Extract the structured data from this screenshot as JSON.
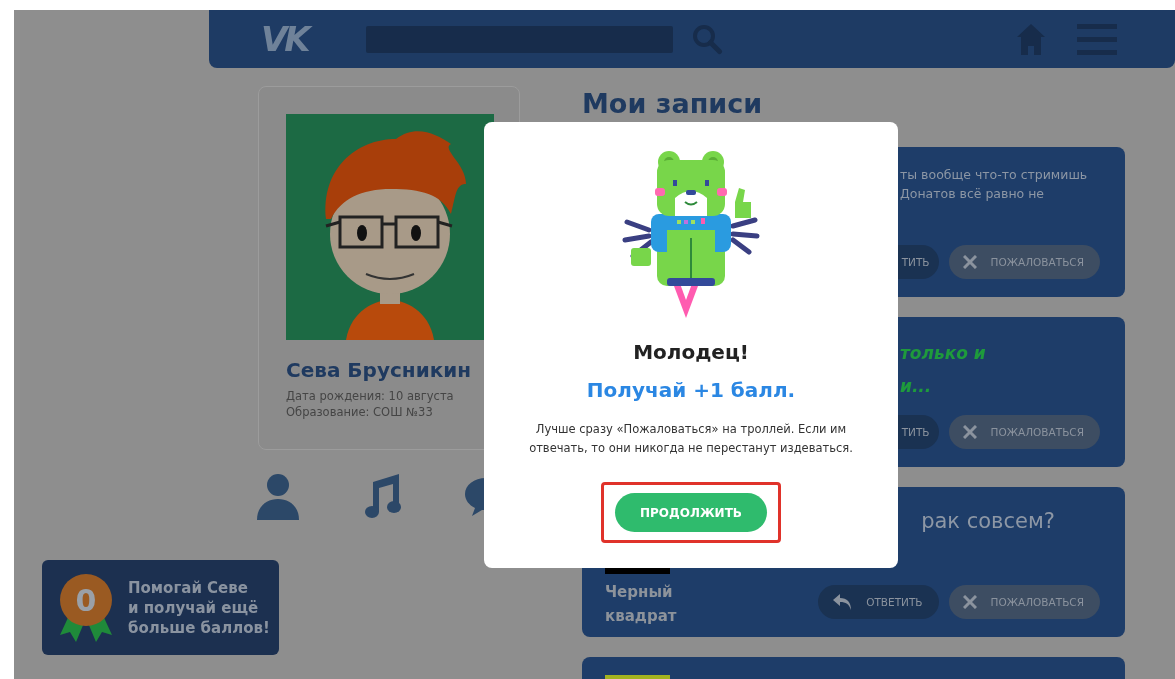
{
  "header": {
    "logo": "VK"
  },
  "profile": {
    "name": "Сева Брусникин",
    "details": [
      "Дата рождения: 10 августа",
      "Образование: СОШ №33"
    ]
  },
  "badge": {
    "count": "0",
    "text": "Помогай Севе\nи получай ещё\nбольше баллов!"
  },
  "feed": {
    "title": "Мои записи",
    "posts": [
      {
        "kind": "text",
        "text": "ты вообще что-то стримишь\nДонатов всё равно не",
        "reply": {
          "label": "ТИТЬ",
          "icon": false
        },
        "report": "ПОЖАЛОВАТЬСЯ"
      },
      {
        "kind": "highlight",
        "text": "только и\nи...",
        "reply": {
          "label": "ТИТЬ",
          "icon": false
        },
        "report": "ПОЖАЛОВАТЬСЯ"
      },
      {
        "kind": "image",
        "color": "#000000",
        "question": "рак совсем?",
        "caption": "Черный\nквадрат",
        "reply": {
          "label": "ОТВЕТИТЬ",
          "icon": true
        },
        "report": "ПОЖАЛОВАТЬСЯ"
      },
      {
        "kind": "image",
        "color": "#a3b31f"
      }
    ]
  },
  "dialog": {
    "title": "Молодец!",
    "subtitle": "Получай +1 балл.",
    "message": "Лучше сразу «Пожаловаться» на троллей. Если им отвечать, то они никогда не перестанут издеваться.",
    "button": {
      "label": "ПРОДОЛЖИТЬ",
      "highlighted": true
    }
  }
}
